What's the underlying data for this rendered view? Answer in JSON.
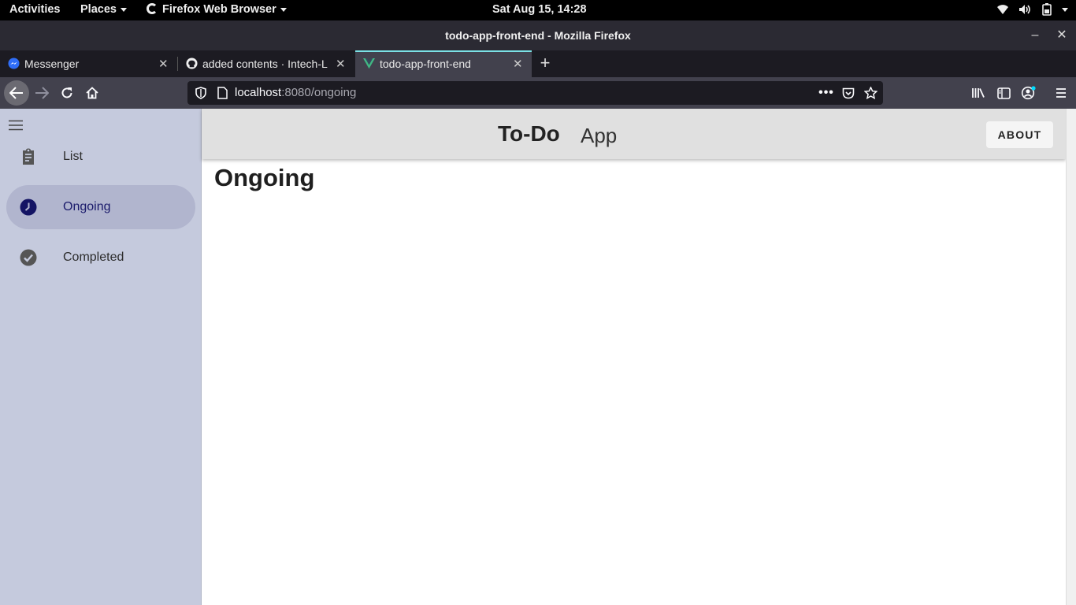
{
  "system_bar": {
    "activities": "Activities",
    "places": "Places",
    "app_menu": "Firefox Web Browser",
    "clock": "Sat Aug 15, 14:28"
  },
  "window": {
    "title": "todo-app-front-end - Mozilla Firefox"
  },
  "tabs": [
    {
      "title": "Messenger",
      "icon": "messenger-icon",
      "active": false
    },
    {
      "title": "added contents · Intech-L",
      "icon": "github-icon",
      "active": false
    },
    {
      "title": "todo-app-front-end",
      "icon": "vue-icon",
      "active": true
    }
  ],
  "urlbar": {
    "host": "localhost",
    "path": ":8080/ongoing"
  },
  "app": {
    "brand_bold": "To-Do",
    "brand_light": "App",
    "about_label": "ABOUT",
    "page_title": "Ongoing",
    "nav": [
      {
        "label": "List",
        "icon": "clipboard-icon",
        "active": false
      },
      {
        "label": "Ongoing",
        "icon": "clock-icon",
        "active": true
      },
      {
        "label": "Completed",
        "icon": "check-circle-icon",
        "active": false
      }
    ]
  },
  "colors": {
    "drawer_bg": "#c5cadd",
    "drawer_active": "#b1b5ce",
    "appbar_bg": "#e0e0e0",
    "tab_accent": "#7be1e6"
  }
}
